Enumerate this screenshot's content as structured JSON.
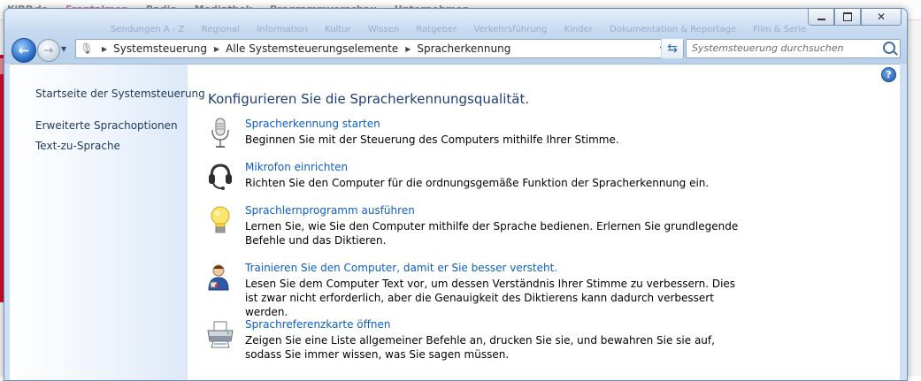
{
  "background_page": {
    "items": [
      "KiRP.de",
      "Frontalmen",
      "Radio",
      "Mediathek",
      "Programmvorschau",
      "Unternehmen"
    ]
  },
  "window": {
    "ghost_menu": [
      "Sendungen A - Z",
      "Regional",
      "Information",
      "Kultur",
      "Wissen",
      "Ratgeber",
      "Verkehrsführung",
      "Kinder",
      "Dokumentation & Reportage",
      "Film & Serie"
    ]
  },
  "caption_buttons": {
    "minimize_icon": "minimize-icon",
    "maximize_icon": "maximize-icon",
    "close_icon": "close-icon"
  },
  "address_bar": {
    "breadcrumbs": [
      "Systemsteuerung",
      "Alle Systemsteuerungselemente",
      "Spracherkennung"
    ]
  },
  "search": {
    "placeholder": "Systemsteuerung durchsuchen"
  },
  "sidebar": {
    "home": "Startseite der Systemsteuerung",
    "links": [
      "Erweiterte Sprachoptionen",
      "Text-zu-Sprache"
    ]
  },
  "main": {
    "heading": "Konfigurieren Sie die Spracherkennungsqualität.",
    "tasks": [
      {
        "icon": "microphone-icon",
        "title": "Spracherkennung starten",
        "desc": "Beginnen Sie mit der Steuerung des Computers mithilfe Ihrer Stimme."
      },
      {
        "icon": "headset-icon",
        "title": "Mikrofon einrichten",
        "desc": "Richten Sie den Computer für die ordnungsgemäße Funktion der Spracherkennung ein."
      },
      {
        "icon": "lightbulb-icon",
        "title": "Sprachlernprogramm ausführen",
        "desc": "Lernen Sie, wie Sie den Computer mithilfe der Sprache bedienen. Erlernen Sie grundlegende Befehle und das Diktieren."
      },
      {
        "icon": "user-speaking-icon",
        "title": "Trainieren Sie den Computer, damit er Sie besser versteht.",
        "desc": "Lesen Sie dem Computer Text vor, um dessen Verständnis Ihrer Stimme zu verbessern. Dies ist zwar nicht erforderlich, aber die Genauigkeit des Diktierens kann dadurch verbessert werden."
      },
      {
        "icon": "printer-icon",
        "title": "Sprachreferenzkarte öffnen",
        "desc": "Zeigen Sie eine Liste allgemeiner Befehle an, drucken Sie sie, und bewahren Sie sie auf, sodass Sie immer wissen, was Sie sagen müssen."
      }
    ]
  }
}
